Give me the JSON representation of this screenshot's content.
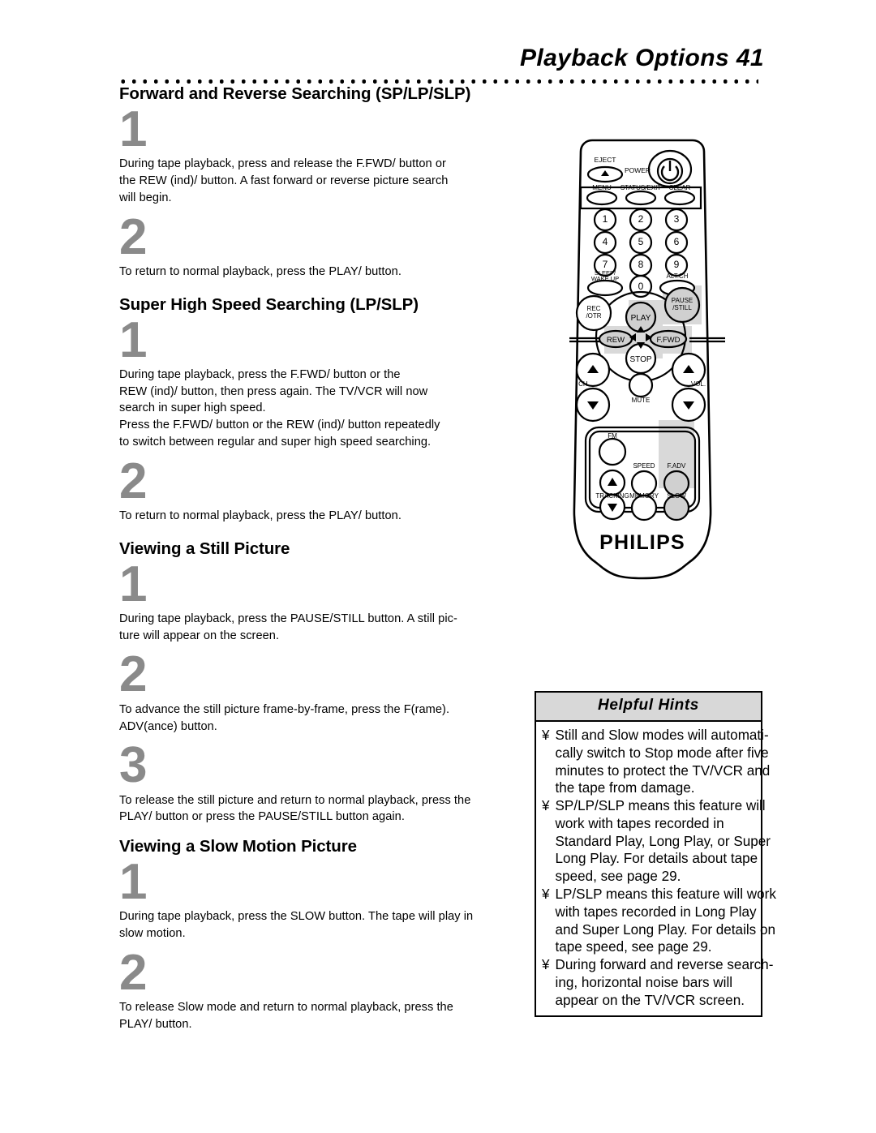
{
  "page": {
    "title": "Playback Options  41",
    "number": "41"
  },
  "sections": [
    {
      "heading": "Forward and Reverse Searching (SP/LP/SLP)",
      "steps": [
        {
          "number": "1",
          "lines": [
            "During tape playback, press and release the F.FWD/    button or",
            "the REW (ind)/    button. A fast forward or reverse picture search",
            "will begin."
          ]
        },
        {
          "number": "2",
          "lines": [
            "To return to normal playback, press the PLAY/    button."
          ]
        }
      ]
    },
    {
      "heading": "Super High Speed Searching (LP/SLP)",
      "steps": [
        {
          "number": "1",
          "lines": [
            "During tape playback, press the F.FWD/    button or the",
            "REW (ind)/    button, then press again. The TV/VCR will now",
            "search in super high speed.",
            "Press the F.FWD/    button or the REW (ind)/    button repeatedly",
            "to switch between regular and super high speed searching."
          ]
        },
        {
          "number": "2",
          "lines": [
            "To return to normal playback, press the PLAY/    button."
          ]
        }
      ]
    },
    {
      "heading": "Viewing a Still Picture",
      "steps": [
        {
          "number": "1",
          "lines": [
            "During tape playback, press the PAUSE/STILL button. A still pic-",
            "ture will appear on the screen."
          ]
        },
        {
          "number": "2",
          "lines": [
            "To advance the still picture frame-by-frame, press the F(rame).",
            "ADV(ance) button."
          ]
        },
        {
          "number": "3",
          "lines": [
            "To release the still picture and return to normal playback, press the",
            "PLAY/    button or press the PAUSE/STILL button again."
          ]
        }
      ]
    },
    {
      "heading": "Viewing a Slow Motion Picture",
      "steps": [
        {
          "number": "1",
          "lines": [
            "During tape playback, press the SLOW button.  The tape will play in",
            "slow motion."
          ]
        },
        {
          "number": "2",
          "lines": [
            "To release Slow mode and return to normal playback, press the",
            "PLAY/    button."
          ]
        }
      ]
    }
  ],
  "hints": {
    "title": "Helpful Hints",
    "bullet": "¥",
    "items": [
      [
        "Still and Slow modes will automati-",
        "cally switch to Stop mode after five",
        "minutes to protect the TV/VCR and",
        "the tape from damage."
      ],
      [
        "SP/LP/SLP means this feature will",
        "work with tapes recorded in",
        "Standard Play, Long Play, or Super",
        "Long Play.  For details about tape",
        "speed, see page 29."
      ],
      [
        "LP/SLP means this feature will work",
        "with tapes recorded in Long Play",
        "and Super Long Play.  For details on",
        "tape speed, see page 29."
      ],
      [
        "During forward and reverse search-",
        "ing, horizontal noise bars will",
        "appear on the TV/VCR screen."
      ]
    ]
  },
  "remote": {
    "brand": "PHILIPS",
    "labels": {
      "eject": "EJECT",
      "power": "POWER",
      "menu": "MENU",
      "status_exit": "STATUS/EXIT",
      "clear": "CLEAR",
      "sleep_wake": "SLEEP/\nWAKE UP",
      "alt_ch": "ALT.CH",
      "rec_otr": "REC\n/OTR",
      "play": "PLAY",
      "pause_still": "PAUSE\n/STILL",
      "rew": "REW",
      "ffwd": "F.FWD",
      "stop": "STOP",
      "ch": "CH.",
      "vol": "VOL.",
      "mute": "MUTE",
      "fm": "FM",
      "speed": "SPEED",
      "f_adv": "F.ADV",
      "tracking": "TRACKING",
      "memory": "MEMORY",
      "slow": "SLOW"
    },
    "keypad": [
      "1",
      "2",
      "3",
      "4",
      "5",
      "6",
      "7",
      "8",
      "9",
      "0"
    ],
    "highlight_color": "#d9d9d9"
  }
}
